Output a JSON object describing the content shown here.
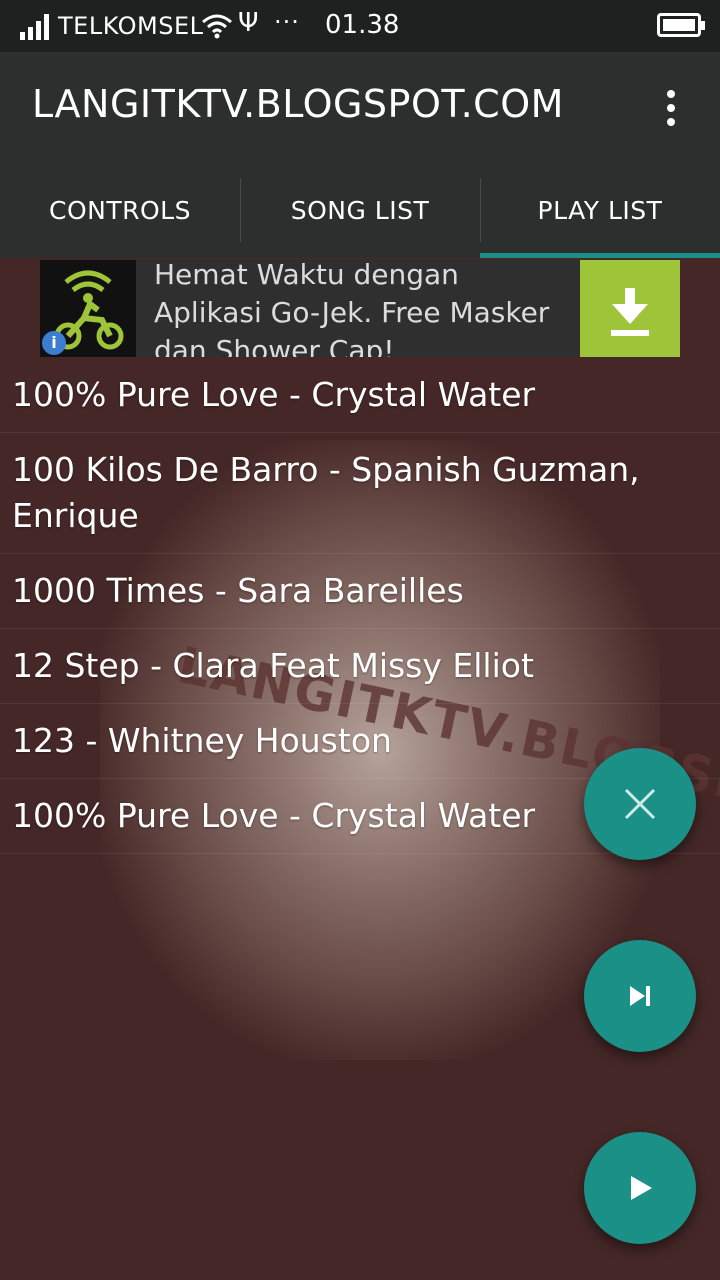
{
  "status_bar": {
    "carrier": "TELKOMSEL",
    "dots": "···",
    "time": "01.38",
    "icons": [
      "signal-icon",
      "wifi-icon",
      "usb-icon",
      "battery-icon"
    ]
  },
  "app_bar": {
    "title": "LANGITKTV.BLOGSPOT.COM",
    "menu_icon": "overflow-menu-icon"
  },
  "tabs": [
    {
      "label": "CONTROLS",
      "selected": false
    },
    {
      "label": "SONG LIST",
      "selected": false
    },
    {
      "label": "PLAY LIST",
      "selected": true
    }
  ],
  "ad": {
    "text": "Hemat Waktu dengan Aplikasi Go-Jek. Free Masker dan Shower Cap!",
    "info_label": "i",
    "icon": "gojek-logo",
    "action_icon": "download-icon"
  },
  "watermark": "LANGITKTV.BLOGSPOT.COM",
  "playlist": [
    "100% Pure Love - Crystal Water",
    "100 Kilos De Barro - Spanish Guzman, Enrique",
    "1000 Times - Sara Bareilles",
    "12 Step - Clara Feat Missy Elliot",
    "123 - Whitney Houston",
    "100% Pure Love - Crystal Water"
  ],
  "fabs": [
    {
      "icon": "close-icon"
    },
    {
      "icon": "skip-next-icon"
    },
    {
      "icon": "play-icon"
    }
  ],
  "colors": {
    "accent": "#1b9087",
    "tab_indicator": "#1b9087",
    "background": "#452727",
    "app_bar": "#2d2f2f",
    "ad_green": "#9ec43a"
  }
}
